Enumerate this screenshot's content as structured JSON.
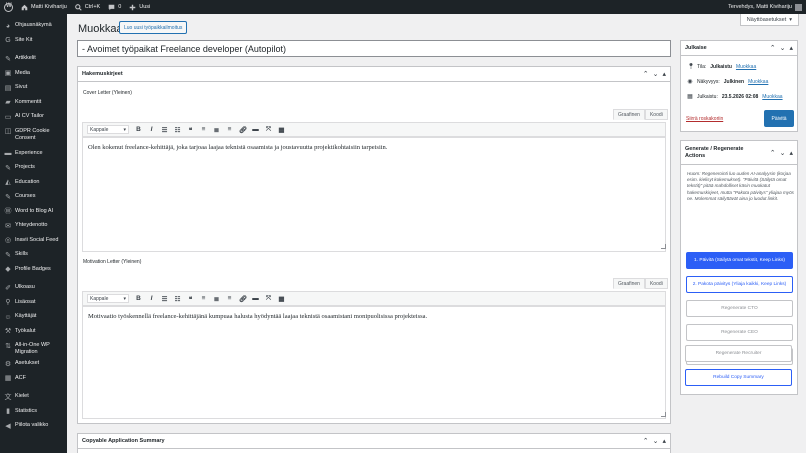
{
  "adminbar": {
    "site_name": "Matti Kivihariju",
    "shortcut": "Ctrl+K",
    "comments_count": "0",
    "new_label": "Uusi",
    "greeting": "Tervehdys, Matti Kivihariju"
  },
  "screen_options": "Näyttöasetukset",
  "sidebar": {
    "items": [
      {
        "label": "Ohjausnäkymä",
        "icon": "dashboard-icon"
      },
      {
        "label": "Site Kit",
        "icon": "sitekit-icon"
      },
      {
        "label": "Artikkelit",
        "icon": "pin-icon"
      },
      {
        "label": "Media",
        "icon": "media-icon"
      },
      {
        "label": "Sivut",
        "icon": "pages-icon"
      },
      {
        "label": "Kommentit",
        "icon": "comments-icon"
      },
      {
        "label": "AI CV Tailor",
        "icon": "document-icon"
      },
      {
        "label": "GDPR Cookie Consent",
        "icon": "cookie-icon"
      },
      {
        "label": "Experience",
        "icon": "briefcase-icon"
      },
      {
        "label": "Projects",
        "icon": "pin-icon"
      },
      {
        "label": "Education",
        "icon": "education-icon"
      },
      {
        "label": "Courses",
        "icon": "pin-icon"
      },
      {
        "label": "Word to Blog AI",
        "icon": "wordpress-icon"
      },
      {
        "label": "Yhteydenotto",
        "icon": "mail-icon"
      },
      {
        "label": "Inavii Social Feed",
        "icon": "feed-icon"
      },
      {
        "label": "Skills",
        "icon": "pin-icon"
      },
      {
        "label": "Profile Badges",
        "icon": "badge-icon"
      },
      {
        "label": "Ulkoasu",
        "icon": "brush-icon"
      },
      {
        "label": "Lisäosat",
        "icon": "plugin-icon"
      },
      {
        "label": "Käyttäjät",
        "icon": "users-icon"
      },
      {
        "label": "Työkalut",
        "icon": "tools-icon"
      },
      {
        "label": "All-in-One WP Migration",
        "icon": "migration-icon"
      },
      {
        "label": "Asetukset",
        "icon": "settings-icon"
      },
      {
        "label": "ACF",
        "icon": "acf-icon"
      },
      {
        "label": "Kielet",
        "icon": "languages-icon"
      },
      {
        "label": "Statistics",
        "icon": "stats-icon"
      },
      {
        "label": "Piilota valikko",
        "icon": "collapse-icon"
      }
    ]
  },
  "page": {
    "title": "Muokkaa",
    "add_new": "Luo uusi työpaikkailmoitus",
    "post_title": "- Avoimet työpaikat Freelance developer (Autopilot)"
  },
  "hakemuskirjeet": {
    "heading": "Hakemuskirjeet",
    "tab_visual": "Graafinen",
    "tab_code": "Koodi",
    "format": "Kappale",
    "cover": {
      "label": "Cover Letter (Yleinen)",
      "content": "Olen kokenut freelance-kehittäjä, joka tarjoaa laajaa teknistä osaamista ja joustavuutta projektikohtaisiin tarpeisiin."
    },
    "motivation": {
      "label": "Motivation Letter (Yleinen)",
      "content": "Motivaatio työskennellä freelance-kehittäjänä kumpuaa halusta hyödyntää laajaa teknistä osaamistani monipuolisissa projekteissa."
    }
  },
  "summary": {
    "heading": "Copyable Application Summary"
  },
  "publish": {
    "heading": "Julkaise",
    "status_label": "Tila:",
    "status_value": "Julkaistu",
    "visibility_label": "Näkyvyys:",
    "visibility_value": "Julkinen",
    "published_label": "Julkaistu:",
    "published_value": "23.5.2026 02:08",
    "edit_link": "Muokkaa",
    "trash": "Siirrä roskakoriin",
    "update": "Päivitä"
  },
  "generate": {
    "heading": "Generate / Regenerate Actions",
    "note": "Huom: Regenerointi luo uuden AI-analyysin (korjaa esim. kielisyt kokemukset). \"Päivitä (Säilytä omat tekstit)\" pitää mahdolliset käsin muokatut hakemuskirjeet, mutta \"Pakota päivitys\" yliajaa myös ne. Molemmat säilyttävät aina jo luodut linkit.",
    "btn_update_keep": "1. Päivitä (Säilytä omat tekstit, Keep Links)",
    "btn_force": "2. Pakota päivitys (Yliaja kaikki, Keep Links)",
    "btn_cto": "Regenerate CTO",
    "btn_ceo": "Regenerate CEO",
    "btn_team_lead": "Regenerate Team Lead",
    "btn_recruiter": "Regenerate Recruiter",
    "btn_copy_summary": "Rebuild Copy Summary"
  },
  "colors": {
    "accent": "#2271b1",
    "primary_generate": "#2c5ff6",
    "admin_dark": "#1d2327"
  }
}
